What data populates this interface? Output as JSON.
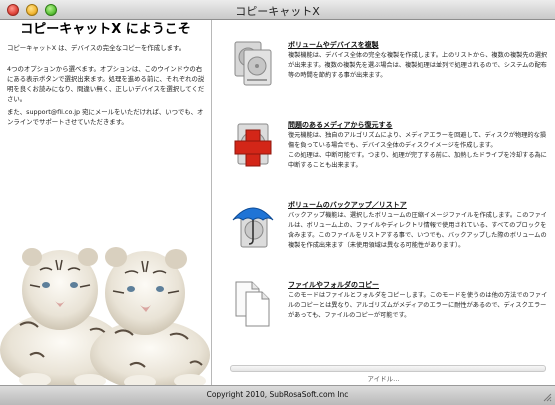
{
  "window": {
    "title": "コピーキャットX"
  },
  "left": {
    "heading": "コピーキャットX にようこそ",
    "intro": "コピーキャットX は、デバイスの完全なコピーを作成します。",
    "options_text": "4つのオプションから選べます。オプションは、このウインドウの右にある表示ボタンで選択出来ます。処理を進める前に、それぞれの説明を良くお読みになり、問違い無く、正しいデバイスを選択してください。",
    "support_text": "また、support@fli.co.jp 宛にメールをいただければ、いつでも、オンラインでサポートさせていただきます。"
  },
  "options": [
    {
      "title": "ボリュームやデバイスを複製",
      "icon": "hard-disk-copy-icon",
      "description": "複製機能は、デバイス全体の完全な複製を作成します。上のリストから、複数の複製先の選択が出来ます。複数の複製先を選ぶ場合は、複製処理は並列で処理されるので、システムの配布等の時間を節約する事が出来ます。"
    },
    {
      "title": "問題のあるメディアから復元する",
      "icon": "recovery-cross-icon",
      "description": "復元機能は、独自のアルゴリズムにより、メディアエラーを回避して、ディスクが物理的な損傷を負っている場合でも、デバイス全体のディスクイメージを作成します。\nこの処理は、中断可能です。つまり、処理が完了する前に、加熱したドライブを冷却する為に中断することも出来ます。"
    },
    {
      "title": "ボリュームのバックアップ／リストア",
      "icon": "umbrella-backup-icon",
      "description": "バックアップ機能は、選択したボリュームの圧縮イメージファイルを作成します。このファイルは、ボリューム上の、ファイルやディレクトリ情報で使用されている、すべてのブロックを含みます。このファイルをリストアする事で、いつでも、バックアップした際のボリュームの複製を作成出来ます（未使用領域は異なる可能性があります）。"
    },
    {
      "title": "ファイルやフォルダのコピー",
      "icon": "documents-copy-icon",
      "description": "このモードはファイルとフォルダをコピーします。このモードを使うのは他の方法でのファイルのコピーとは異なり、アルゴリズムがメディアのエラーに耐性があるので、ディスクエラーがあっても、ファイルのコピーが可能です。"
    }
  ],
  "status": {
    "text": "アイドル…",
    "progress": 0
  },
  "footer": {
    "copyright": "Copyright 2010, SubRosaSoft.com Inc"
  }
}
